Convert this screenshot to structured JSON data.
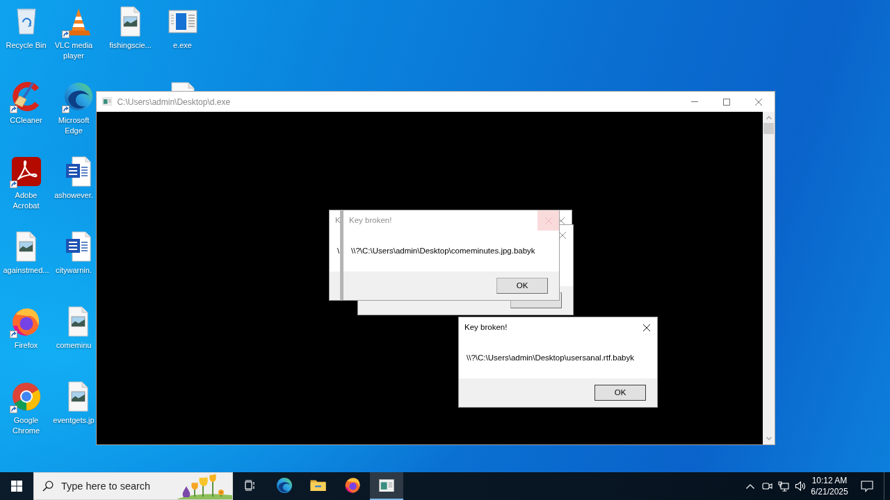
{
  "desktop": {
    "icon_columns": [
      [
        {
          "label": "Recycle Bin",
          "kind": "recycle-bin",
          "shortcut": false
        },
        {
          "label": "CCleaner",
          "kind": "ccleaner",
          "shortcut": true
        },
        {
          "label": "Adobe Acrobat",
          "kind": "acrobat",
          "shortcut": true
        },
        {
          "label": "againstmed...",
          "kind": "image-file",
          "shortcut": false
        },
        {
          "label": "Firefox",
          "kind": "firefox",
          "shortcut": true
        },
        {
          "label": "Google Chrome",
          "kind": "chrome",
          "shortcut": true
        }
      ],
      [
        {
          "label": "VLC media player",
          "kind": "vlc",
          "shortcut": true
        },
        {
          "label": "Microsoft Edge",
          "kind": "edge",
          "shortcut": true
        },
        {
          "label": "ashowever.",
          "kind": "word-doc",
          "shortcut": false
        },
        {
          "label": "citywarnin.",
          "kind": "word-doc",
          "shortcut": false
        },
        {
          "label": "comeminu",
          "kind": "image-file",
          "shortcut": false
        },
        {
          "label": "eventgets.jp",
          "kind": "image-file",
          "shortcut": false
        }
      ],
      [
        {
          "label": "fishingscie...",
          "kind": "image-file",
          "shortcut": false
        }
      ],
      [
        {
          "label": "e.exe",
          "kind": "exe-window",
          "shortcut": false
        },
        {
          "kind": "blank-file-top"
        }
      ]
    ]
  },
  "console_window": {
    "title": "C:\\Users\\admin\\Desktop\\d.exe",
    "active": false
  },
  "dialogs": [
    {
      "title": "K",
      "message": "\\",
      "active": false,
      "close_highlighted": false
    },
    {
      "active": false,
      "close_highlighted": false,
      "button": {
        "focused": false
      }
    },
    {
      "title": "Key broken!",
      "message": "\\\\?\\C:\\Users\\admin\\Desktop\\comeminutes.jpg.babyk",
      "active": false,
      "close_highlighted": true,
      "button": {
        "label": "OK",
        "focused": false
      }
    },
    {
      "title": "Key broken!",
      "message": "\\\\?\\C:\\Users\\admin\\Desktop\\usersanal.rtf.babyk",
      "active": true,
      "close_highlighted": false,
      "button": {
        "label": "OK",
        "focused": true
      }
    }
  ],
  "taskbar": {
    "search": {
      "placeholder": "Type here to search"
    },
    "apps": [
      {
        "kind": "task-view",
        "selected": false
      },
      {
        "kind": "edge",
        "selected": false
      },
      {
        "kind": "file-explorer",
        "selected": false
      },
      {
        "kind": "firefox",
        "selected": false
      },
      {
        "kind": "console",
        "selected": true
      }
    ],
    "clock": {
      "time": "10:12 AM",
      "date": "6/21/2025"
    }
  }
}
